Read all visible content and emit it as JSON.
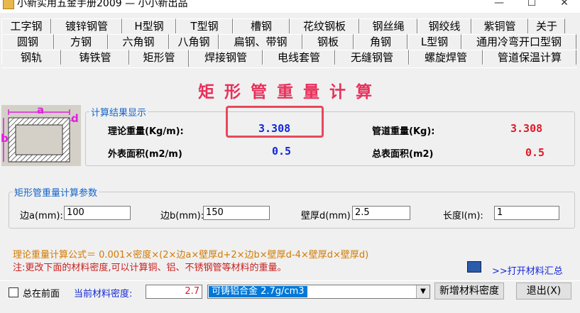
{
  "window": {
    "title": "小新实用五金手册2009 — 小小新出品",
    "minimize": "—",
    "maximize": "☐",
    "close": "✕"
  },
  "tabs": {
    "row1": [
      "工字钢",
      "镀锌钢管",
      "H型钢",
      "T型钢",
      "槽钢",
      "花纹钢板",
      "钢丝绳",
      "钢绞线",
      "紫铜管",
      "关于"
    ],
    "row2": [
      "圆钢",
      "方钢",
      "六角钢",
      "八角钢",
      "扁钢、带钢",
      "钢板",
      "角钢",
      "L型钢",
      "通用冷弯开口型钢"
    ],
    "row3": [
      "钢轨",
      "铸铁管",
      "矩形管",
      "焊接钢管",
      "电线套管",
      "无缝钢管",
      "螺旋焊管",
      "管道保温计算"
    ],
    "active": "矩形管"
  },
  "main": {
    "heading": "矩形管重量计算",
    "diagram": {
      "a": "a",
      "b": "b",
      "d": "d"
    },
    "result_group": {
      "label": "计算结果显示",
      "theoretical_weight_label": "理论重量(Kg/m):",
      "theoretical_weight_value": "3.308",
      "pipe_weight_label": "管道重量(Kg):",
      "pipe_weight_value": "3.308",
      "outer_area_label": "外表面积(m2/m)",
      "outer_area_value": "0.5",
      "total_area_label": "总表面积(m2)",
      "total_area_value": "0.5"
    },
    "param_group": {
      "label": "矩形管重量计算参数",
      "side_a_label": "边a(mm):",
      "side_a_value": "100",
      "side_b_label": "边b(mm):",
      "side_b_value": "150",
      "wall_label": "壁厚d(mm)",
      "wall_value": "2.5",
      "length_label": "长度l(m):",
      "length_value": "1"
    },
    "formula": "理论重量计算公式＝ 0.001×密度×(2×边a×壁厚d+2×边b×壁厚d-4×壁厚d×壁厚d)",
    "note": "注:更改下面的材料密度,可以计算铜、铝、不锈钢管等材料的重量。",
    "open_summary": ">>打开材料汇总"
  },
  "bottom": {
    "always_on_top_label": "总在前面",
    "always_on_top_checked": false,
    "density_label": "当前材料密度:",
    "density_value": "2.7",
    "material_selected": "可铸铝合金 2.7g/cm3",
    "add_density_button": "新增材料密度",
    "exit_button": "退出(X)"
  },
  "colors": {
    "heading": "#e8305a",
    "blue_value": "#1428d8",
    "red_value": "#e01a2a",
    "group_label": "#1464c8",
    "highlight": "#e8485a"
  }
}
